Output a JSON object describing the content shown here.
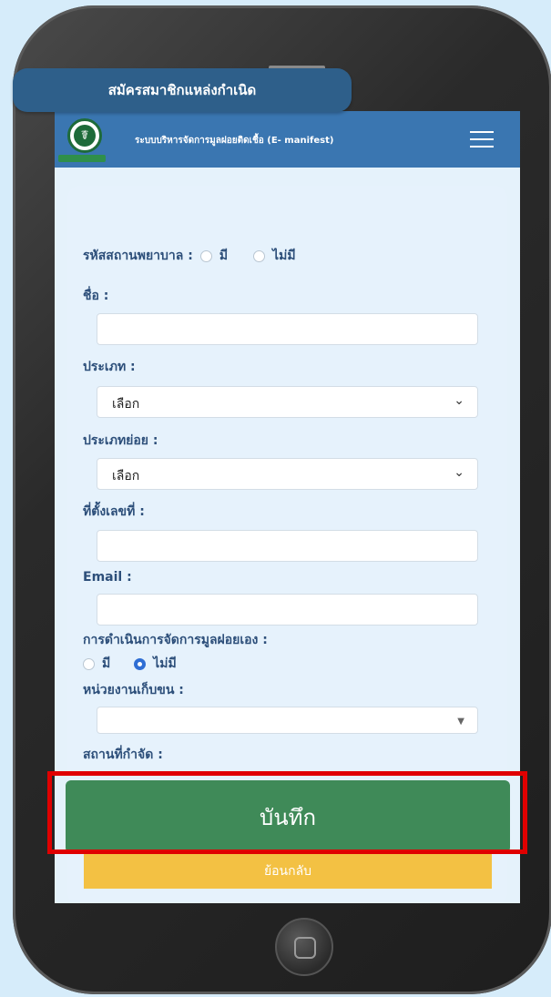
{
  "header": {
    "title": "ระบบบริหารจัดการมูลฝอยติดเชื้อ (E- manifest)",
    "logo_icon": "ministry-logo",
    "menu_icon": "hamburger-menu-icon"
  },
  "form": {
    "title": "สมัครสมาชิกแหล่งกำเนิด",
    "hospital_code_label": "รหัสสถานพยาบาล :",
    "hospital_code_options": [
      "มี",
      "ไม่มี"
    ],
    "name_label": "ชื่อ :",
    "name_value": "",
    "type_label": "ประเภท :",
    "type_value": "เลือก",
    "subtype_label": "ประเภทย่อย :",
    "subtype_value": "เลือก",
    "address_label": "ที่ตั้งเลขที่ :",
    "address_value": "",
    "email_label": "Email :",
    "email_value": "",
    "self_manage_label": "การดำเนินการจัดการมูลฝอยเอง :",
    "self_manage_options": [
      "มี",
      "ไม่มี"
    ],
    "self_manage_selected": "ไม่มี",
    "collector_label": "หน่วยงานเก็บขน :",
    "collector_value": "",
    "disposal_label": "สถานที่กำจัด :"
  },
  "actions": {
    "save_label": "บันทึก",
    "back_label": "ย้อนกลับ"
  },
  "colors": {
    "page_bg": "#d6ecfa",
    "topbar": "#3a76b1",
    "header_pill": "#2e5f8a",
    "save_button": "#3f8a58",
    "back_button": "#f3c143",
    "highlight": "#e00000"
  }
}
